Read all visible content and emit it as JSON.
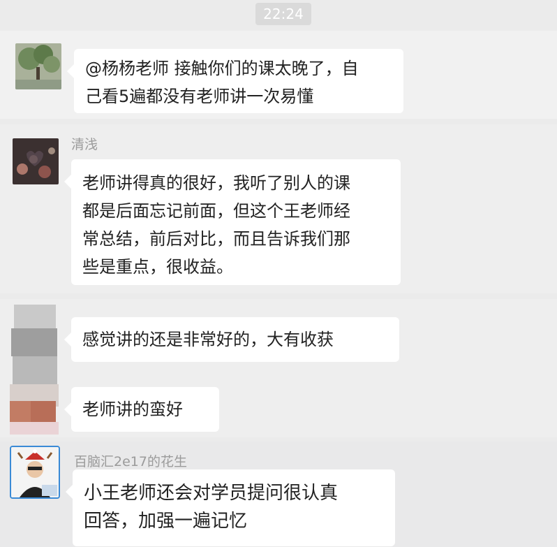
{
  "timestamp": "22:24",
  "messages": [
    {
      "sender": "",
      "text_lines": [
        "@杨杨老师 接触你们的课太晚了，自",
        "己看5遍都没有老师讲一次易懂"
      ]
    },
    {
      "sender": "清浅",
      "text_lines": [
        "老师讲得真的很好，我听了别人的课",
        "都是后面忘记前面，但这个王老师经",
        "常总结，前后对比，而且告诉我们那",
        "些是重点，很收益。"
      ]
    },
    {
      "sender": "",
      "text_lines": [
        "感觉讲的还是非常好的，大有收获"
      ]
    },
    {
      "sender": "",
      "text_lines": [
        "老师讲的蛮好"
      ]
    },
    {
      "sender": "百脑汇2e17的花生",
      "text_lines": [
        "小王老师还会对学员提问很认真",
        "回答，加强一遍记忆"
      ]
    }
  ]
}
